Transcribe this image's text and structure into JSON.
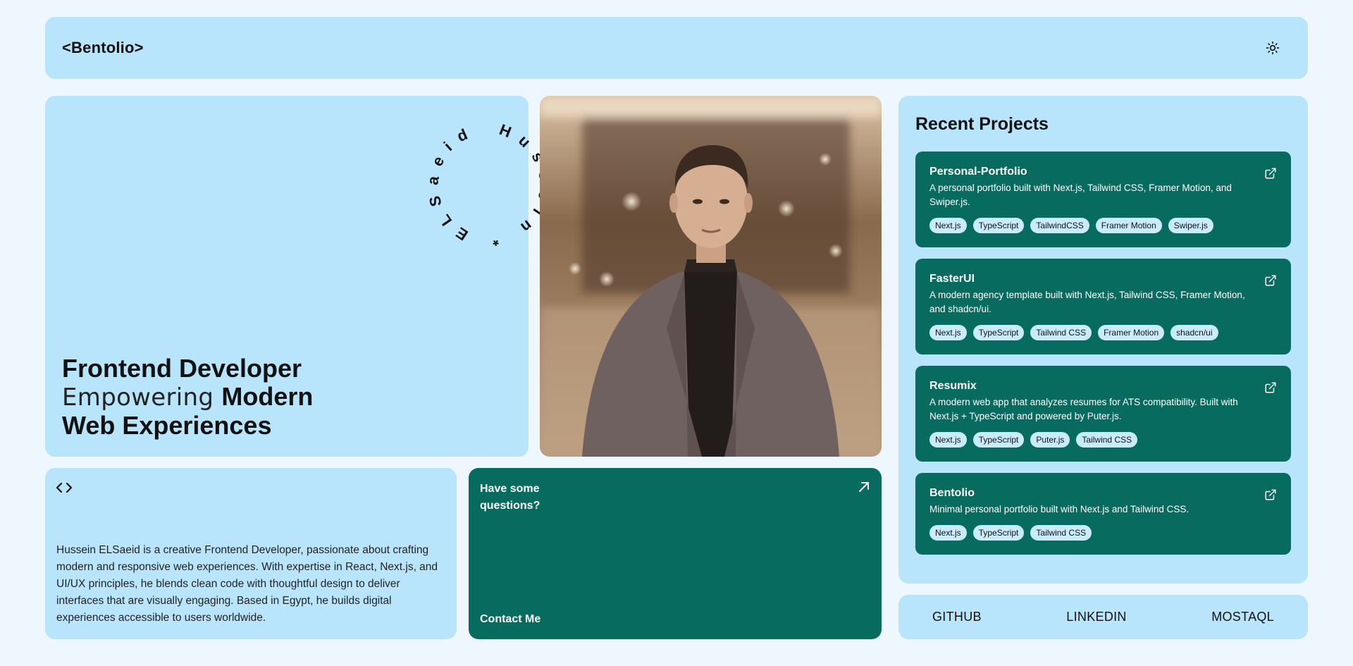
{
  "header": {
    "logo": "<Bentolio>",
    "theme_icon": "sun-icon"
  },
  "hero": {
    "circle_text": "Hussein * ELSaeid * ",
    "line1": "Frontend Developer",
    "line2_light": "Empowering ",
    "line2_bold": "Modern",
    "line3": "Web Experiences"
  },
  "about": {
    "icon": "code-icon",
    "text": "Hussein ELSaeid is a creative Frontend Developer, passionate about crafting modern and responsive web experiences. With expertise in React, Next.js, and UI/UX principles, he blends clean code with thoughtful design to deliver interfaces that are visually engaging. Based in Egypt, he builds digital experiences accessible to users worldwide."
  },
  "contact": {
    "question": "Have some questions?",
    "cta": "Contact Me",
    "icon": "arrow-up-right-icon"
  },
  "projects": {
    "title": "Recent Projects",
    "items": [
      {
        "name": "Personal-Portfolio",
        "desc": "A personal portfolio built with Next.js, Tailwind CSS, Framer Motion, and Swiper.js.",
        "tags": [
          "Next.js",
          "TypeScript",
          "TailwindCSS",
          "Framer Motion",
          "Swiper.js"
        ]
      },
      {
        "name": "FasterUI",
        "desc": "A modern agency template built with Next.js, Tailwind CSS, Framer Motion, and shadcn/ui.",
        "tags": [
          "Next.js",
          "TypeScript",
          "Tailwind CSS",
          "Framer Motion",
          "shadcn/ui"
        ]
      },
      {
        "name": "Resumix",
        "desc": "A modern web app that analyzes resumes for ATS compatibility. Built with Next.js + TypeScript and powered by Puter.js.",
        "tags": [
          "Next.js",
          "TypeScript",
          "Puter.js",
          "Tailwind CSS"
        ]
      },
      {
        "name": "Bentolio",
        "desc": "Minimal personal portfolio built with Next.js and Tailwind CSS.",
        "tags": [
          "Next.js",
          "TypeScript",
          "Tailwind CSS"
        ]
      }
    ]
  },
  "socials": {
    "github": "GITHUB",
    "linkedin": "LINKEDIN",
    "mostaql": "MOSTAQL"
  },
  "colors": {
    "background": "#eff7fe",
    "card_light": "#b8e5fb",
    "card_dark": "#086b5f",
    "tag_bg": "#c8ecfd"
  }
}
